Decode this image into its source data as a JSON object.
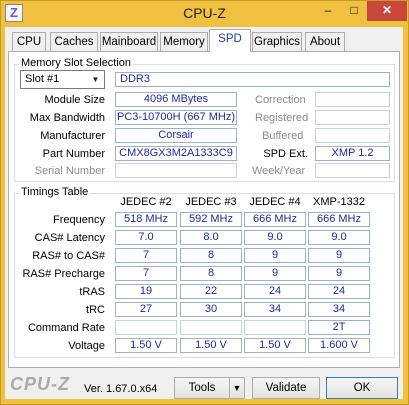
{
  "window": {
    "title": "CPU-Z",
    "app_icon": "Z",
    "minimize_glyph": "–",
    "maximize_glyph": "□",
    "close_glyph": "✕"
  },
  "tabs": [
    {
      "label": "CPU"
    },
    {
      "label": "Caches"
    },
    {
      "label": "Mainboard"
    },
    {
      "label": "Memory"
    },
    {
      "label": "SPD"
    },
    {
      "label": "Graphics"
    },
    {
      "label": "About"
    }
  ],
  "active_tab": "SPD",
  "memory_slot": {
    "group_title": "Memory Slot Selection",
    "slot_selected": "Slot #1",
    "type": "DDR3",
    "labels": {
      "module_size": "Module Size",
      "max_bandwidth": "Max Bandwidth",
      "manufacturer": "Manufacturer",
      "part_number": "Part Number",
      "serial_number": "Serial Number",
      "correction": "Correction",
      "registered": "Registered",
      "buffered": "Buffered",
      "spd_ext": "SPD Ext.",
      "week_year": "Week/Year"
    },
    "values": {
      "module_size": "4096 MBytes",
      "max_bandwidth": "PC3-10700H (667 MHz)",
      "manufacturer": "Corsair",
      "part_number": "CMX8GX3M2A1333C9",
      "serial_number": "",
      "correction": "",
      "registered": "",
      "buffered": "",
      "spd_ext": "XMP 1.2",
      "week_year": ""
    }
  },
  "timings": {
    "group_title": "Timings Table",
    "columns": [
      "JEDEC #2",
      "JEDEC #3",
      "JEDEC #4",
      "XMP-1332"
    ],
    "rows": [
      {
        "label": "Frequency",
        "values": [
          "518 MHz",
          "592 MHz",
          "666 MHz",
          "666 MHz"
        ]
      },
      {
        "label": "CAS# Latency",
        "values": [
          "7.0",
          "8.0",
          "9.0",
          "9.0"
        ]
      },
      {
        "label": "RAS# to CAS#",
        "values": [
          "7",
          "8",
          "9",
          "9"
        ]
      },
      {
        "label": "RAS# Precharge",
        "values": [
          "7",
          "8",
          "9",
          "9"
        ]
      },
      {
        "label": "tRAS",
        "values": [
          "19",
          "22",
          "24",
          "24"
        ]
      },
      {
        "label": "tRC",
        "values": [
          "27",
          "30",
          "34",
          "34"
        ]
      },
      {
        "label": "Command Rate",
        "values": [
          "",
          "",
          "",
          "2T"
        ]
      },
      {
        "label": "Voltage",
        "values": [
          "1.50 V",
          "1.50 V",
          "1.50 V",
          "1.600 V"
        ]
      }
    ]
  },
  "footer": {
    "logo": "CPU-Z",
    "version": "Ver. 1.67.0.x64",
    "tools_label": "Tools",
    "tools_arrow": "▼",
    "validate_label": "Validate",
    "ok_label": "OK"
  }
}
